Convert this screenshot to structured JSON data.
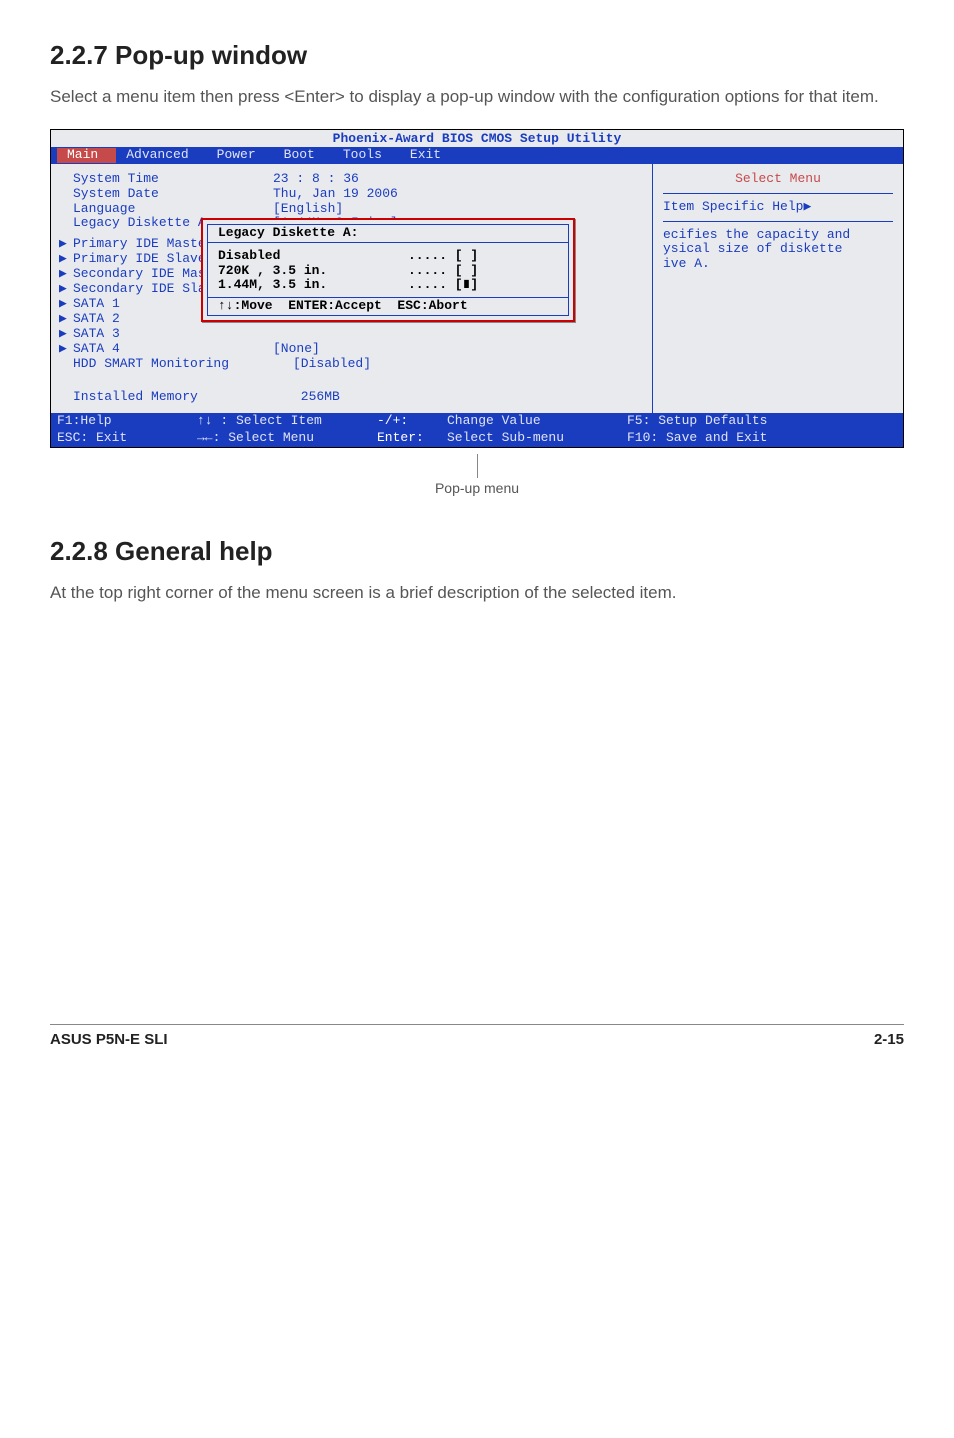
{
  "sections": {
    "s1": {
      "heading": "2.2.7  Pop-up window",
      "text": "Select a menu item then press <Enter> to display a pop-up window with the configuration options for that item."
    },
    "s2": {
      "heading": "2.2.8  General help",
      "text": "At the top right corner of the menu screen is a brief description of the selected item."
    }
  },
  "caption": "Pop-up menu",
  "footer": {
    "left": "ASUS P5N-E SLI",
    "right": "2-15"
  },
  "bios": {
    "title": "Phoenix-Award BIOS CMOS Setup Utility",
    "menubar": [
      "Main",
      "Advanced",
      "Power",
      "Boot",
      "Tools",
      "Exit"
    ],
    "active_tab": "Main",
    "rows": {
      "system_time": {
        "label": "System Time",
        "value": "23 : 8 : 36"
      },
      "system_date": {
        "label": "System Date",
        "value": "Thu, Jan 19 2006"
      },
      "language": {
        "label": "Language",
        "value": "[English]"
      },
      "legacy_diskette": {
        "label": "Legacy Diskette A:",
        "value": "[1.44M, 3.5 in.]"
      },
      "primary_master": {
        "label": "Primary IDE Master"
      },
      "primary_slave": {
        "label": "Primary IDE Slave"
      },
      "secondary_master": {
        "label": "Secondary IDE Master"
      },
      "secondary_slave": {
        "label": "Secondary IDE Slave"
      },
      "sata1": {
        "label": "SATA 1"
      },
      "sata2": {
        "label": "SATA 2"
      },
      "sata3": {
        "label": "SATA 3"
      },
      "sata4": {
        "label": "SATA 4"
      },
      "hdd_smart": {
        "label": "HDD SMART Monitoring",
        "value": "[Disabled]"
      },
      "installed_mem": {
        "label": "Installed Memory",
        "value": " 256MB"
      },
      "none_val": "[None]"
    },
    "right_panel": {
      "select_menu": "Select Menu",
      "item_specific": "Item Specific Help",
      "help_line1": "ecifies the capacity and",
      "help_line2": "ysical size of diskette",
      "help_line3": "ive A."
    },
    "popup": {
      "title": "Legacy Diskette A:",
      "options": [
        {
          "name": "Disabled",
          "mark": "..... [ ]"
        },
        {
          "name": "720K , 3.5 in.",
          "mark": "..... [ ]"
        },
        {
          "name": "1.44M, 3.5 in.",
          "mark": "..... [∎]"
        }
      ],
      "nav": "↑↓:Move  ENTER:Accept  ESC:Abort"
    },
    "footer_keys": {
      "f1": "F1:Help",
      "sel_item": "↑↓ : Select Item",
      "change": "-/+:",
      "change_val": " Change Value",
      "f5": "F5: Setup Defaults",
      "esc": "ESC: Exit",
      "sel_menu": "→←: Select Menu",
      "enter": "Enter:",
      "submenu": " Select Sub-menu",
      "f10": "F10: Save and Exit"
    }
  }
}
